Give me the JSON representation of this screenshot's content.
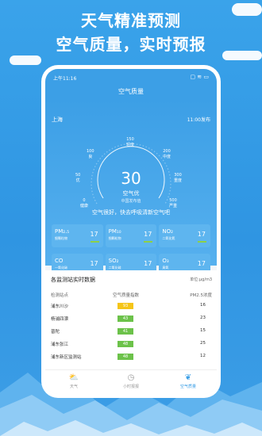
{
  "promo": {
    "line1": "天气精准预测",
    "line2": "空气质量，实时预报"
  },
  "status": {
    "time": "上午11:16",
    "icons": "▢ ≋ ▭"
  },
  "topbar": {
    "title": "空气质量"
  },
  "hero": {
    "city": "上海",
    "publish": "11:00发布",
    "aqi": "30",
    "level": "空气优",
    "source": "中国发布值",
    "tip": "空气很好，快去呼吸清新空气吧",
    "scale": [
      {
        "v": "0",
        "l": "健康"
      },
      {
        "v": "50",
        "l": "优"
      },
      {
        "v": "100",
        "l": "良"
      },
      {
        "v": "150",
        "l": "轻度"
      },
      {
        "v": "200",
        "l": "中度"
      },
      {
        "v": "300",
        "l": "重度"
      },
      {
        "v": "500",
        "l": "严重"
      }
    ]
  },
  "pollutants": [
    {
      "name": "PM₂.₅",
      "sub": "细颗粒物",
      "value": "17"
    },
    {
      "name": "PM₁₀",
      "sub": "细颗粒物",
      "value": "17"
    },
    {
      "name": "NO₂",
      "sub": "二氧化氮",
      "value": "17"
    },
    {
      "name": "CO",
      "sub": "一氧化碳",
      "value": "17"
    },
    {
      "name": "SO₂",
      "sub": "二氧化硫",
      "value": "17"
    },
    {
      "name": "O₃",
      "sub": "臭氧",
      "value": "17"
    }
  ],
  "stations": {
    "title": "各监测站实时数据",
    "unit": "单位:μg/m3",
    "headers": [
      "检测站点",
      "空气质量指数",
      "PM2.5浓度"
    ],
    "rows": [
      {
        "name": "浦东川沙",
        "aqi": "93",
        "pm": "16",
        "color": "#f5c518"
      },
      {
        "name": "杨浦四漂",
        "aqi": "43",
        "pm": "23",
        "color": "#6cc24a"
      },
      {
        "name": "普陀",
        "aqi": "41",
        "pm": "15",
        "color": "#6cc24a"
      },
      {
        "name": "浦东张江",
        "aqi": "48",
        "pm": "25",
        "color": "#6cc24a"
      },
      {
        "name": "浦东新区监测站",
        "aqi": "48",
        "pm": "12",
        "color": "#6cc24a"
      }
    ]
  },
  "tabs": [
    {
      "label": "天气",
      "icon": "weather-icon",
      "glyph": "⛅"
    },
    {
      "label": "小时报报",
      "icon": "clock-icon",
      "glyph": "◷"
    },
    {
      "label": "空气质量",
      "icon": "leaf-icon",
      "glyph": "❦"
    }
  ]
}
